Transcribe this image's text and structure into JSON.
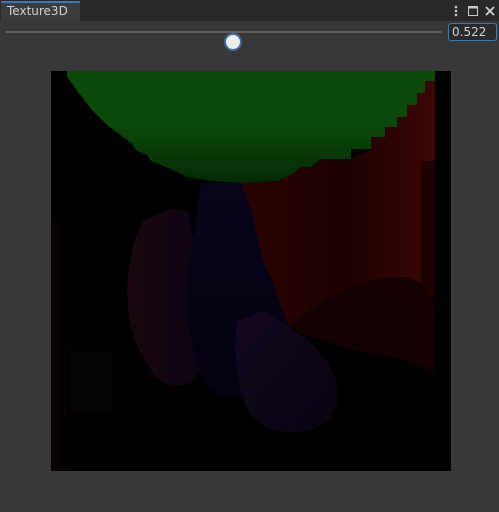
{
  "window": {
    "tab_title": "Texture3D",
    "controls": {
      "menu_icon": "more-vertical-icon",
      "maximize_icon": "maximize-icon",
      "close_icon": "close-icon"
    }
  },
  "slider": {
    "value": 0.522,
    "display_value": "0.522",
    "min": 0,
    "max": 1,
    "accent_color": "#3a79bb"
  },
  "preview": {
    "background_color": "#000000"
  }
}
